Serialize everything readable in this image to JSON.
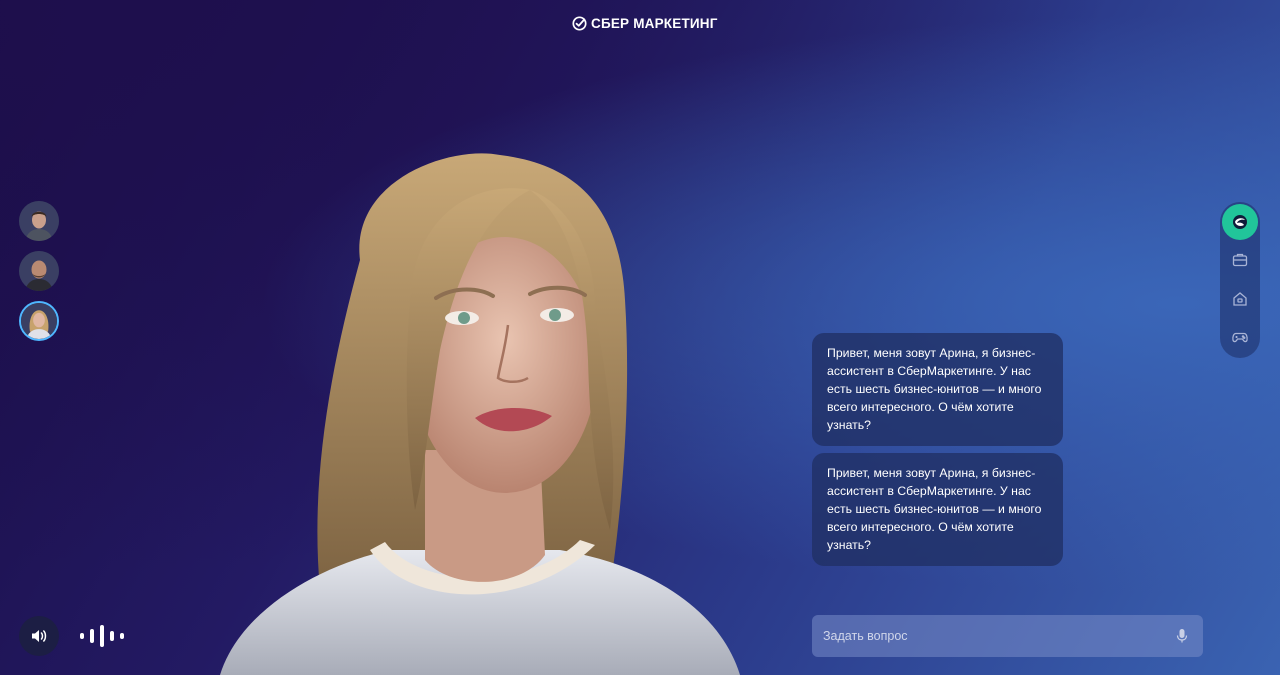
{
  "header": {
    "logo_text": "СБЕР МАРКЕТИНГ",
    "logo_icon": "sber-check-icon"
  },
  "personas": [
    {
      "name": "persona-man-1",
      "icon": "avatar-man-icon",
      "active": false
    },
    {
      "name": "persona-man-2",
      "icon": "avatar-man-bald-icon",
      "active": false
    },
    {
      "name": "persona-arina",
      "icon": "avatar-woman-icon",
      "active": true
    }
  ],
  "rail": {
    "items": [
      {
        "icon": "assistant-swirl-icon",
        "active": true
      },
      {
        "icon": "briefcase-icon",
        "active": false
      },
      {
        "icon": "home-icon",
        "active": false
      },
      {
        "icon": "gamepad-icon",
        "active": false
      }
    ],
    "active_color": "#21c59a"
  },
  "chat": {
    "messages": [
      "Привет, меня зовут Арина, я бизнес-ассистент в СберМаркетинге. У нас есть шесть бизнес-юнитов — и много всего интересного. О чём хотите узнать?",
      "Привет, меня зовут Арина, я бизнес-ассистент в СберМаркетинге. У нас есть шесть бизнес-юнитов — и много всего интересного. О чём хотите узнать?"
    ]
  },
  "input": {
    "placeholder": "Задать вопрос",
    "value": "",
    "icon": "microphone-icon"
  },
  "controls": {
    "sound_icon": "speaker-icon",
    "wave_icon": "voice-wave-icon"
  }
}
